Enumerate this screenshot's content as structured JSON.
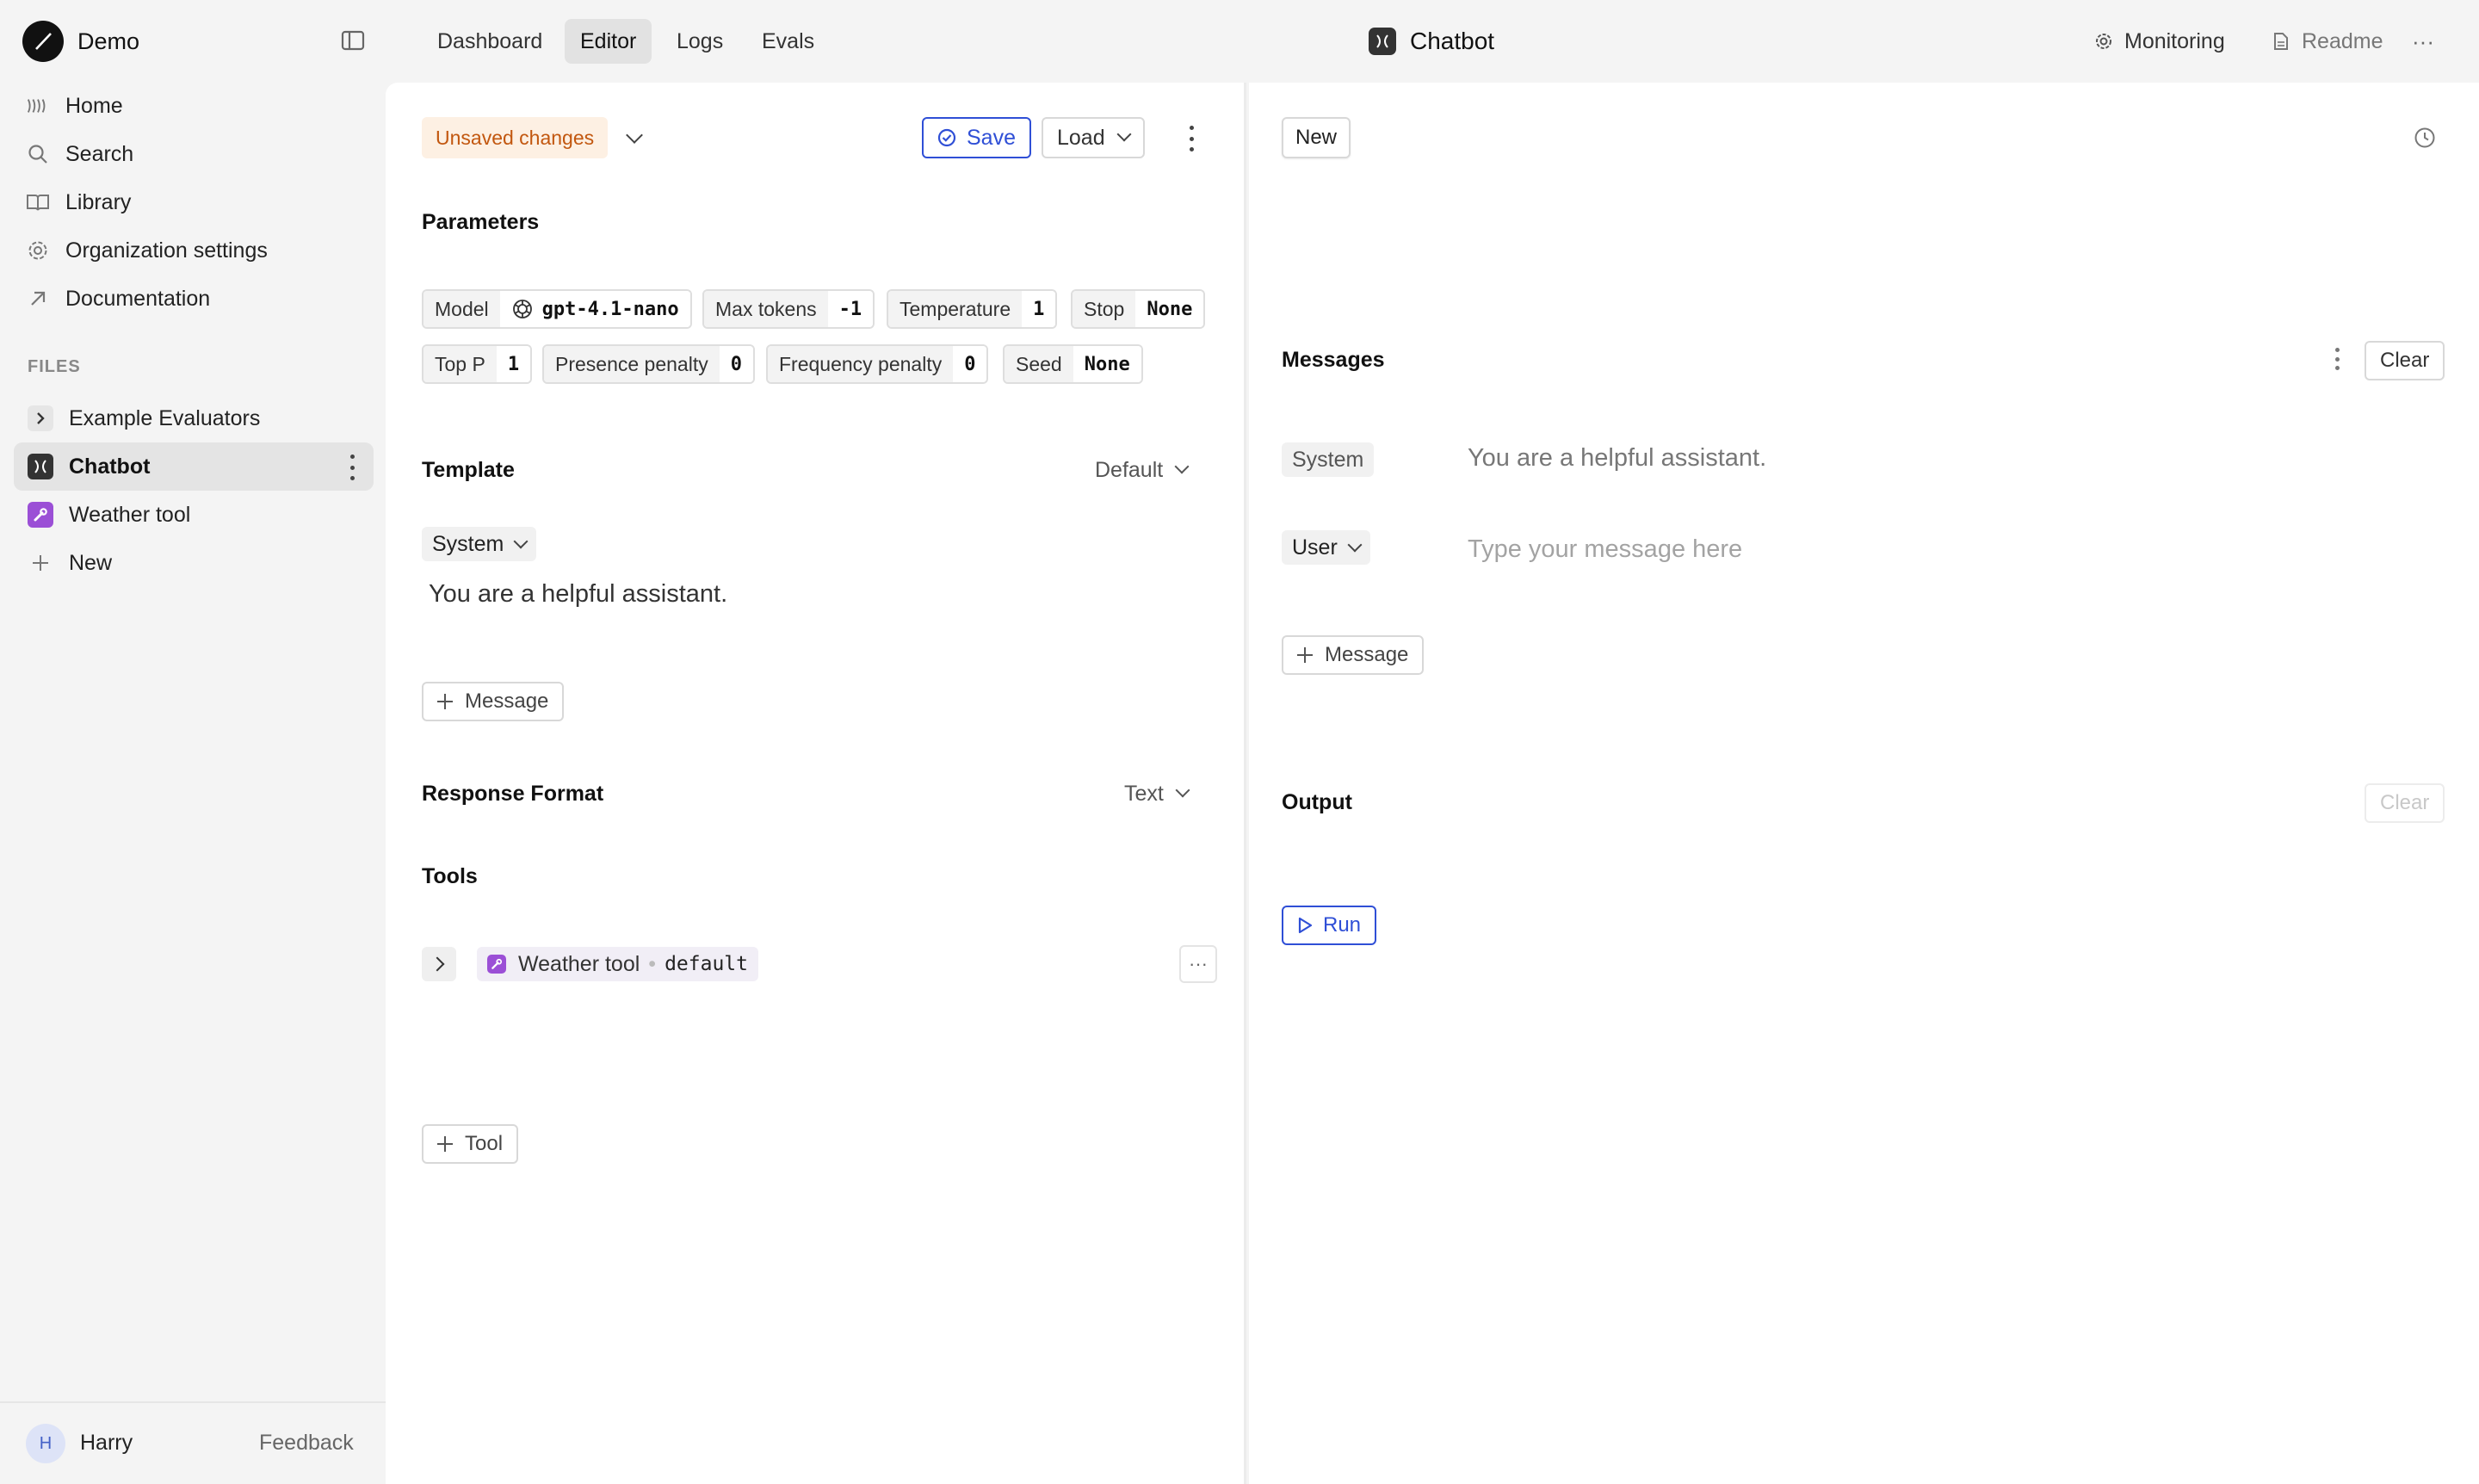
{
  "org": {
    "name": "Demo"
  },
  "nav": [
    {
      "label": "Home",
      "icon": "home-icon"
    },
    {
      "label": "Search",
      "icon": "search-icon"
    },
    {
      "label": "Library",
      "icon": "library-icon"
    },
    {
      "label": "Organization settings",
      "icon": "gear-icon"
    },
    {
      "label": "Documentation",
      "icon": "external-arrow-icon"
    }
  ],
  "files": {
    "section_label": "FILES",
    "items": [
      {
        "label": "Example Evaluators",
        "type": "folder"
      },
      {
        "label": "Chatbot",
        "type": "prompt",
        "active": true
      },
      {
        "label": "Weather tool",
        "type": "tool"
      },
      {
        "label": "New",
        "type": "new"
      }
    ]
  },
  "user": {
    "initial": "H",
    "name": "Harry",
    "feedback": "Feedback"
  },
  "topbar": {
    "tabs": [
      "Dashboard",
      "Editor",
      "Logs",
      "Evals"
    ],
    "active_tab": "Editor",
    "file_title": "Chatbot",
    "monitoring": "Monitoring",
    "readme": "Readme",
    "more": "···"
  },
  "editor": {
    "status": "Unsaved changes",
    "save": "Save",
    "load": "Load",
    "parameters_title": "Parameters",
    "parameters": [
      {
        "label": "Model",
        "value": "gpt-4.1-nano"
      },
      {
        "label": "Max tokens",
        "value": "-1"
      },
      {
        "label": "Temperature",
        "value": "1"
      },
      {
        "label": "Stop",
        "value": "None"
      },
      {
        "label": "Top P",
        "value": "1"
      },
      {
        "label": "Presence penalty",
        "value": "0"
      },
      {
        "label": "Frequency penalty",
        "value": "0"
      },
      {
        "label": "Seed",
        "value": "None"
      }
    ],
    "template_title": "Template",
    "template_mode": "Default",
    "template_role": "System",
    "template_message": "You are a helpful assistant.",
    "add_message": "Message",
    "response_format_title": "Response Format",
    "response_format": "Text",
    "tools_title": "Tools",
    "tool": {
      "name": "Weather tool",
      "version": "default",
      "more": "···"
    },
    "add_tool": "Tool"
  },
  "playground": {
    "new": "New",
    "messages_title": "Messages",
    "clear": "Clear",
    "system_role": "System",
    "system_message": "You are a helpful assistant.",
    "user_role": "User",
    "user_placeholder": "Type your message here",
    "add_message": "Message",
    "output_title": "Output",
    "output_clear": "Clear",
    "run": "Run"
  }
}
